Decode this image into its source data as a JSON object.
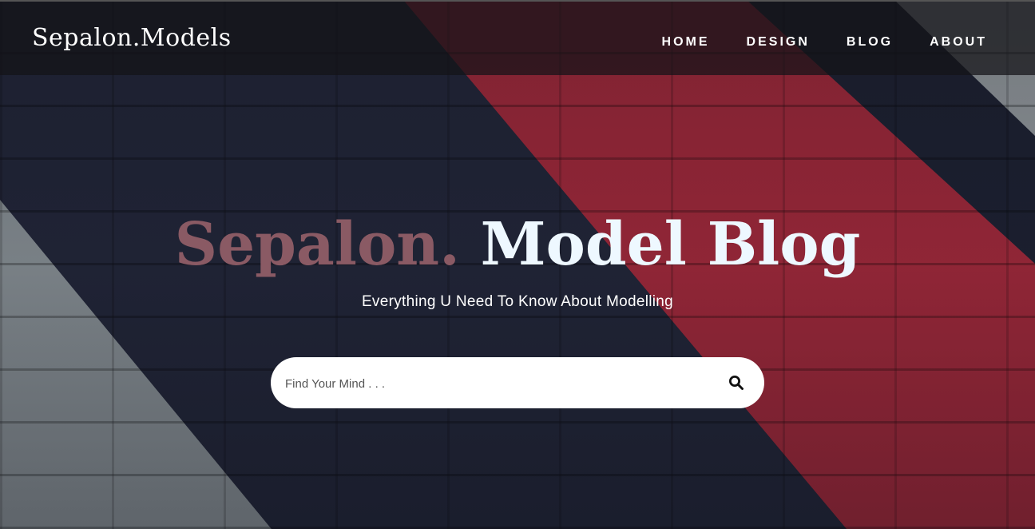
{
  "header": {
    "logo": "Sepalon.Models",
    "nav": [
      "HOME",
      "DESIGN",
      "BLOG",
      "ABOUT"
    ]
  },
  "hero": {
    "title_part1": "Sepalon.",
    "title_part2": "Model Blog",
    "subtitle": "Everything U Need To Know About Modelling"
  },
  "search": {
    "placeholder": "Find Your Mind . . .",
    "value": "",
    "icon": "search-icon"
  },
  "colors": {
    "stripe_red": "#b22a3a",
    "stripe_dark": "#1e2233",
    "stripe_gray": "#8c9499",
    "title_accent": "#8a5a64",
    "title_main": "#eef8ff"
  }
}
